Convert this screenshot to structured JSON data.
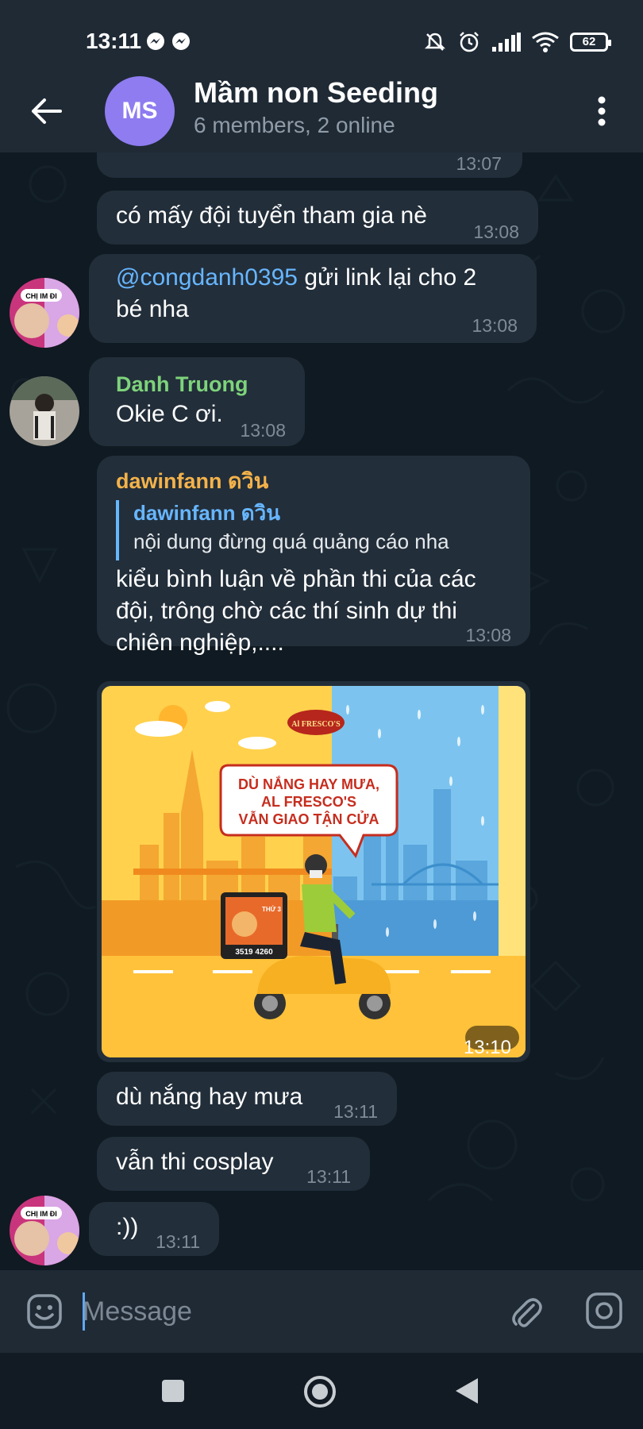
{
  "status_bar": {
    "time": "13:11",
    "battery": "62"
  },
  "header": {
    "avatar_initials": "MS",
    "title": "Mầm non Seeding",
    "subtitle": "6 members, 2 online"
  },
  "messages": [
    {
      "time": "13:07"
    },
    {
      "text": "có mấy đội tuyển tham gia nè",
      "time": "13:08"
    },
    {
      "mention": "@congdanh0395",
      "text_line1": " gửi link lại cho 2",
      "text_line2": "bé nha",
      "time": "13:08"
    },
    {
      "sender": "Danh Truong",
      "sender_color": "#7ed37b",
      "text": "Okie C ơi.",
      "time": "13:08"
    },
    {
      "sender": "dawinfann ดวิน",
      "sender_color": "#f4b24a",
      "reply_sender": "dawinfann ดวิน",
      "reply_text": "nội dung đừng quá quảng cáo nha",
      "text_line1": "kiểu bình luận về phần thi của các",
      "text_line2": "đội, trông chờ các thí sinh dự thi",
      "text_line3": "chiên nghiệp,....",
      "time": "13:08"
    },
    {
      "image": {
        "logo": "Al FRESCO'S",
        "headline_line1": "DÙ NẮNG HAY MƯA,",
        "headline_line2": "AL FRESCO'S",
        "headline_line3": "VẪN GIAO TẬN CỬA",
        "box_label": "THỨ 3",
        "box_phone": "3519 4260"
      },
      "time": "13:10"
    },
    {
      "text": "dù nắng hay mưa",
      "time": "13:11"
    },
    {
      "text": "vẫn thi cosplay",
      "time": "13:11"
    },
    {
      "text": ":))",
      "time": "13:11"
    }
  ],
  "avatar_labels": {
    "sticker_text": "CHỊ IM ĐI"
  },
  "input": {
    "placeholder": "Message"
  },
  "colors": {
    "header_bg": "#1f2a35",
    "bubble_bg": "#222e3a",
    "mention": "#67b6ff",
    "accent_avatar": "#8e7cf0"
  },
  "icons": [
    "messenger-icon",
    "mute-bell-icon",
    "alarm-icon",
    "signal-icon",
    "wifi-icon",
    "battery-icon",
    "back-arrow-icon",
    "more-vert-icon",
    "emoji-icon",
    "attach-icon",
    "camera-icon",
    "nav-recents-icon",
    "nav-home-icon",
    "nav-back-icon"
  ]
}
